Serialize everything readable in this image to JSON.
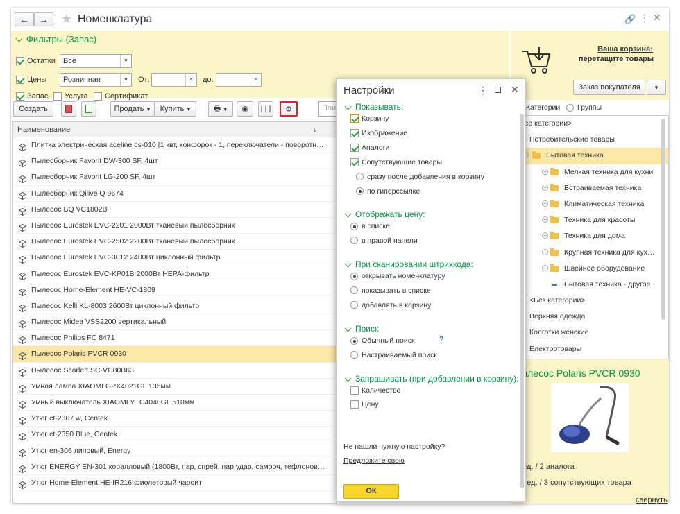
{
  "window": {
    "title": "Номенклатура",
    "back": "←",
    "forward": "→"
  },
  "filters": {
    "title": "Фильтры (Запас)",
    "ostatki_label": "Остатки",
    "ostatki_value": "Все",
    "ceny_label": "Цены",
    "ceny_value": "Розничная",
    "from_label": "От:",
    "to_label": "до:",
    "zapas_label": "Запас",
    "usluga_label": "Услуга",
    "sertifikat_label": "Сертификат"
  },
  "toolbar": {
    "create": "Создать",
    "sell": "Продать",
    "buy": "Купить",
    "search_placeholder": "Поиск"
  },
  "grid": {
    "col_name": "Наименование",
    "sort_arrow": "↓",
    "col_other": "О"
  },
  "items": [
    "Плитка электрическая aceline cs-010 [1 квт, конфорок - 1, переключатели - поворотн…",
    "Пылесборник Favorit DW-300 SF, 4шт",
    "Пылесборник Favorit LG-200 SF, 4шт",
    "Пылесборник Qilive Q 9674",
    "Пылесос BQ VC1802B",
    "Пылесос Eurostek EVC-2201 2000Вт тканевый пылесборник",
    "Пылесос Eurostek EVC-2502 2200Вт тканевый пылесборник",
    "Пылесос Eurostek EVC-3012 2400Вт циклонный фильтр",
    "Пылесос Eurostek EVC-KP01B 2000Вт HEPA-фильтр",
    "Пылесос Home-Element HE-VC-1809",
    "Пылесос Kelli KL-8003 2600Вт циклонный фильтр",
    "Пылесос Midea VSS2200 вертикальный",
    "Пылесос Philips FC 8471",
    "Пылесос Polaris PVCR 0930",
    "Пылесос Scarlett SC-VC80B63",
    "Умная лампа XIAOMI GPX4021GL 135мм",
    "Умный выключатель XIAOMI YTC4040GL 510мм",
    "Утюг ct-2307 w, Centek",
    "Утюг ct-2350 Blue, Centek",
    "Утюг en-306 липовый, Energy",
    "Утюг ENERGY EN-301 коралловый (1800Вт, пар, спрей, пар.удар, самооч, тефлонов…",
    "Утюг Home-Element HE-IR216 фиолетовый чароит"
  ],
  "selected_item": "Пылесос Polaris PVCR 0930",
  "cart": {
    "title": "Ваша корзина:",
    "subtitle": "перетащите товары",
    "order_btn": "Заказ покупателя"
  },
  "view": {
    "categories": "Категории",
    "groups": "Группы"
  },
  "tree": [
    {
      "label": "<Все категории>",
      "type": "text",
      "indent": 0
    },
    {
      "label": "Потребительские товары",
      "type": "folder",
      "indent": 0
    },
    {
      "label": "Бытовая техника",
      "type": "folder-open",
      "indent": 1
    },
    {
      "label": "Мелкая техника для кухни",
      "type": "folder-plus",
      "indent": 2
    },
    {
      "label": "Встраиваемая техника",
      "type": "folder-plus",
      "indent": 2
    },
    {
      "label": "Климатическая техника",
      "type": "folder-plus",
      "indent": 2
    },
    {
      "label": "Техника для красоты",
      "type": "folder-plus",
      "indent": 2
    },
    {
      "label": "Техника для дома",
      "type": "folder-plus",
      "indent": 2
    },
    {
      "label": "Крупная техника для кух…",
      "type": "folder-plus",
      "indent": 2
    },
    {
      "label": "Швейное оборудование",
      "type": "folder-plus",
      "indent": 2
    },
    {
      "label": "Бытовая техника - другое",
      "type": "dash",
      "indent": 2
    },
    {
      "label": "<Без категории>",
      "type": "dash",
      "indent": 0
    },
    {
      "label": "Верхняя одежда",
      "type": "dash",
      "indent": 0
    },
    {
      "label": "Колготки женские",
      "type": "dash",
      "indent": 0
    },
    {
      "label": "Електротовары",
      "type": "dash",
      "indent": 0
    }
  ],
  "product": {
    "title": "Пылесос Polaris PVCR 0930",
    "stock_link": "5 ед. / 2 аналога",
    "related_link": "35 ед. / 3 сопутствующих товара",
    "collapse": "свернуть"
  },
  "settings": {
    "title": "Настройки",
    "show_label": "Показывать:",
    "basket": "Корзину",
    "image": "Изображение",
    "analogs": "Аналоги",
    "related": "Сопутствующие товары",
    "after_add": "сразу после добавления в корзину",
    "by_link": "по гиперссылке",
    "price_label": "Отображать цену:",
    "in_list": "в списке",
    "in_right_panel": "в правой панели",
    "scan_label": "При сканировании штрихкода:",
    "open_item": "открывать номенклатуру",
    "show_in_list": "показывать в списке",
    "add_to_cart": "добавлять в корзину",
    "search_label": "Поиск",
    "simple_search": "Обычный поиск",
    "help": "?",
    "custom_search": "Настраиваемый поиск",
    "ask_label": "Запрашивать (при добавлении в корзину):",
    "quantity": "Количество",
    "price": "Цену",
    "not_found": "Не нашли нужную настройку?",
    "suggest": "Предложите свою",
    "ok": "ОК"
  }
}
